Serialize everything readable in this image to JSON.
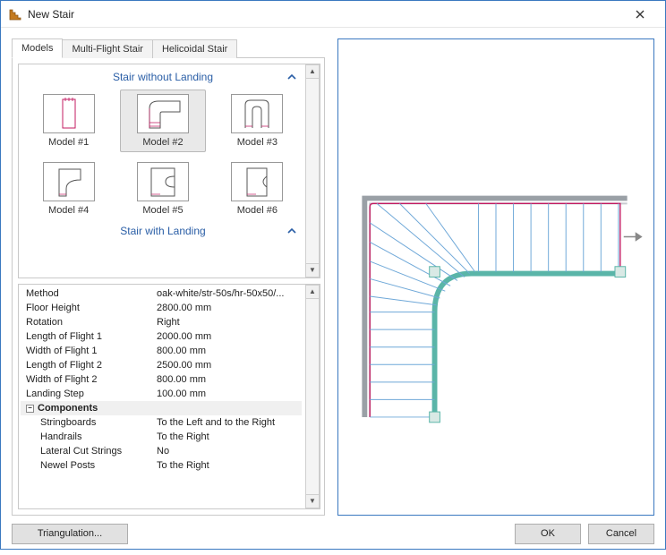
{
  "window": {
    "title": "New Stair"
  },
  "tabs": [
    {
      "id": "models",
      "label": "Models",
      "active": true
    },
    {
      "id": "multi",
      "label": "Multi-Flight Stair",
      "active": false
    },
    {
      "id": "heli",
      "label": "Helicoidal Stair",
      "active": false
    }
  ],
  "sections": {
    "without": {
      "title": "Stair without Landing"
    },
    "with": {
      "title": "Stair with Landing"
    }
  },
  "models": [
    {
      "id": 1,
      "label": "Model #1",
      "selected": false
    },
    {
      "id": 2,
      "label": "Model #2",
      "selected": true
    },
    {
      "id": 3,
      "label": "Model #3",
      "selected": false
    },
    {
      "id": 4,
      "label": "Model #4",
      "selected": false
    },
    {
      "id": 5,
      "label": "Model #5",
      "selected": false
    },
    {
      "id": 6,
      "label": "Model #6",
      "selected": false
    }
  ],
  "props": {
    "method": {
      "k": "Method",
      "v": "oak-white/str-50s/hr-50x50/..."
    },
    "floor_height": {
      "k": "Floor Height",
      "v": "2800.00 mm"
    },
    "rotation": {
      "k": "Rotation",
      "v": "Right"
    },
    "len_flight_1": {
      "k": "Length of Flight 1",
      "v": "2000.00 mm"
    },
    "wid_flight_1": {
      "k": "Width of Flight 1",
      "v": "800.00 mm"
    },
    "len_flight_2": {
      "k": "Length of Flight 2",
      "v": "2500.00 mm"
    },
    "wid_flight_2": {
      "k": "Width of Flight 2",
      "v": "800.00 mm"
    },
    "landing_step": {
      "k": "Landing Step",
      "v": "100.00 mm"
    },
    "components_group": {
      "k": "Components"
    },
    "stringboards": {
      "k": "Stringboards",
      "v": "To the Left and to the Right"
    },
    "handrails": {
      "k": "Handrails",
      "v": "To the Right"
    },
    "lateral_cut": {
      "k": "Lateral Cut Strings",
      "v": "No"
    },
    "newel_posts": {
      "k": "Newel Posts",
      "v": "To the Right"
    }
  },
  "buttons": {
    "triangulation": "Triangulation...",
    "ok": "OK",
    "cancel": "Cancel"
  },
  "group_collapse_glyph": "−"
}
